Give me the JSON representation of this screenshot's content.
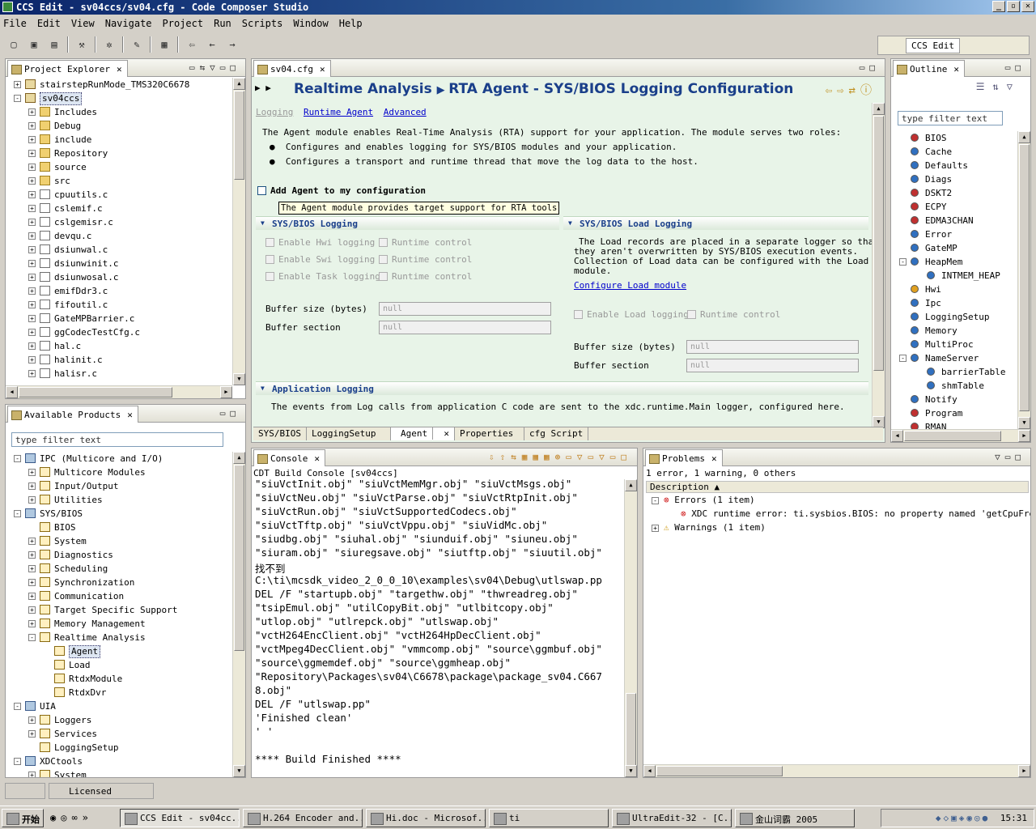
{
  "window": {
    "title": "CCS Edit - sv04ccs/sv04.cfg - Code Composer Studio",
    "controls": [
      "_",
      "▫",
      "✕"
    ]
  },
  "menu": [
    "File",
    "Edit",
    "View",
    "Navigate",
    "Project",
    "Run",
    "Scripts",
    "Window",
    "Help"
  ],
  "perspective": {
    "label": "CCS Edit"
  },
  "project_explorer": {
    "tab": "Project Explorer",
    "items": [
      {
        "label": "stairstepRunMode_TMS320C6678",
        "depth": 0,
        "kind": "prj",
        "expander": "+"
      },
      {
        "label": "sv04ccs",
        "depth": 0,
        "kind": "prj",
        "expander": "-",
        "selected": true
      },
      {
        "label": "Includes",
        "depth": 1,
        "kind": "folder",
        "expander": "+"
      },
      {
        "label": "Debug",
        "depth": 1,
        "kind": "folder",
        "expander": "+"
      },
      {
        "label": "include",
        "depth": 1,
        "kind": "folder",
        "expander": "+"
      },
      {
        "label": "Repository",
        "depth": 1,
        "kind": "folder",
        "expander": "+"
      },
      {
        "label": "source",
        "depth": 1,
        "kind": "folder",
        "expander": "+"
      },
      {
        "label": "src",
        "depth": 1,
        "kind": "folder",
        "expander": "+"
      },
      {
        "label": "cpuutils.c",
        "depth": 1,
        "kind": "file",
        "expander": "+"
      },
      {
        "label": "cslemif.c",
        "depth": 1,
        "kind": "file",
        "expander": "+"
      },
      {
        "label": "cslgemisr.c",
        "depth": 1,
        "kind": "file",
        "expander": "+"
      },
      {
        "label": "devqu.c",
        "depth": 1,
        "kind": "file",
        "expander": "+"
      },
      {
        "label": "dsiunwal.c",
        "depth": 1,
        "kind": "file",
        "expander": "+"
      },
      {
        "label": "dsiunwinit.c",
        "depth": 1,
        "kind": "file",
        "expander": "+"
      },
      {
        "label": "dsiunwosal.c",
        "depth": 1,
        "kind": "file",
        "expander": "+"
      },
      {
        "label": "emifDdr3.c",
        "depth": 1,
        "kind": "file",
        "expander": "+"
      },
      {
        "label": "fifoutil.c",
        "depth": 1,
        "kind": "file",
        "expander": "+"
      },
      {
        "label": "GateMPBarrier.c",
        "depth": 1,
        "kind": "file",
        "expander": "+"
      },
      {
        "label": "ggCodecTestCfg.c",
        "depth": 1,
        "kind": "file",
        "expander": "+"
      },
      {
        "label": "hal.c",
        "depth": 1,
        "kind": "file",
        "expander": "+"
      },
      {
        "label": "halinit.c",
        "depth": 1,
        "kind": "file",
        "expander": "+"
      },
      {
        "label": "halisr.c",
        "depth": 1,
        "kind": "file",
        "expander": "+"
      }
    ]
  },
  "available_products": {
    "tab": "Available Products",
    "filter_placeholder": "type filter text",
    "items": [
      {
        "label": "IPC (Multicore and I/O)",
        "depth": 0,
        "kind": "pkg",
        "expander": "-"
      },
      {
        "label": "Multicore Modules",
        "depth": 1,
        "kind": "mod",
        "expander": "+"
      },
      {
        "label": "Input/Output",
        "depth": 1,
        "kind": "mod",
        "expander": "+"
      },
      {
        "label": "Utilities",
        "depth": 1,
        "kind": "mod",
        "expander": "+"
      },
      {
        "label": "SYS/BIOS",
        "depth": 0,
        "kind": "pkg",
        "expander": "-"
      },
      {
        "label": "BIOS",
        "depth": 1,
        "kind": "mod",
        "expander": ""
      },
      {
        "label": "System",
        "depth": 1,
        "kind": "mod",
        "expander": "+"
      },
      {
        "label": "Diagnostics",
        "depth": 1,
        "kind": "mod",
        "expander": "+"
      },
      {
        "label": "Scheduling",
        "depth": 1,
        "kind": "mod",
        "expander": "+"
      },
      {
        "label": "Synchronization",
        "depth": 1,
        "kind": "mod",
        "expander": "+"
      },
      {
        "label": "Communication",
        "depth": 1,
        "kind": "mod",
        "expander": "+"
      },
      {
        "label": "Target Specific Support",
        "depth": 1,
        "kind": "mod",
        "expander": "+"
      },
      {
        "label": "Memory Management",
        "depth": 1,
        "kind": "mod",
        "expander": "+"
      },
      {
        "label": "Realtime Analysis",
        "depth": 1,
        "kind": "mod",
        "expander": "-"
      },
      {
        "label": "Agent",
        "depth": 2,
        "kind": "mod",
        "expander": "",
        "selected": true
      },
      {
        "label": "Load",
        "depth": 2,
        "kind": "mod",
        "expander": ""
      },
      {
        "label": "RtdxModule",
        "depth": 2,
        "kind": "mod",
        "expander": ""
      },
      {
        "label": "RtdxDvr",
        "depth": 2,
        "kind": "mod",
        "expander": ""
      },
      {
        "label": "UIA",
        "depth": 0,
        "kind": "pkg",
        "expander": "-"
      },
      {
        "label": "Loggers",
        "depth": 1,
        "kind": "mod",
        "expander": "+"
      },
      {
        "label": "Services",
        "depth": 1,
        "kind": "mod",
        "expander": "+"
      },
      {
        "label": "LoggingSetup",
        "depth": 1,
        "kind": "mod",
        "expander": ""
      },
      {
        "label": "XDCtools",
        "depth": 0,
        "kind": "pkg",
        "expander": "-"
      },
      {
        "label": "System",
        "depth": 1,
        "kind": "mod",
        "expander": "+"
      }
    ]
  },
  "editor": {
    "tab": "sv04.cfg",
    "breadcrumb_1": "Realtime Analysis",
    "breadcrumb_2": "RTA Agent - SYS/BIOS Logging Configuration",
    "links": {
      "logging": "Logging",
      "runtime_agent": "Runtime Agent",
      "advanced": "Advanced"
    },
    "intro": "The Agent module enables Real-Time Analysis (RTA) support for your application. The module serves two roles:",
    "bullet_1": "Configures and enables logging for SYS/BIOS modules and your application.",
    "bullet_2": "Configures a transport and runtime thread that move the log data to the host.",
    "add_agent": "Add Agent to my configuration",
    "tooltip": "The Agent module provides target support for RTA tools",
    "sysbios_logging": {
      "title": "SYS/BIOS Logging",
      "hwi": "Enable Hwi logging",
      "swi": "Enable Swi logging",
      "task": "Enable Task logging",
      "runtime": "Runtime control",
      "buffer_size_label": "Buffer size (bytes)",
      "buffer_section_label": "Buffer section",
      "buffer_size_value": "null",
      "buffer_section_value": "null"
    },
    "load_logging": {
      "title": "SYS/BIOS Load Logging",
      "desc_1": "The Load records are placed in a separate logger so that",
      "desc_2": "they aren't overwritten by SYS/BIOS execution events.",
      "desc_3": "Collection of Load data can be configured with the Load",
      "desc_4": "module.",
      "configure_link": "Configure Load module",
      "enable": "Enable Load logging",
      "runtime": "Runtime control",
      "buffer_size_label": "Buffer size (bytes)",
      "buffer_section_label": "Buffer section",
      "buffer_size_value": "null",
      "buffer_section_value": "null"
    },
    "app_logging": {
      "title": "Application Logging",
      "desc": "The events from Log calls from application C code are sent to the xdc.runtime.Main logger, configured here."
    },
    "bottom_tabs": [
      "SYS/BIOS",
      "LoggingSetup",
      "Agent",
      "Properties",
      "cfg Script"
    ]
  },
  "outline": {
    "tab": "Outline",
    "filter_placeholder": "type filter text",
    "items": [
      {
        "label": "BIOS",
        "color": "#c03030",
        "depth": 0
      },
      {
        "label": "Cache",
        "color": "#3070c0",
        "depth": 0
      },
      {
        "label": "Defaults",
        "color": "#3070c0",
        "depth": 0
      },
      {
        "label": "Diags",
        "color": "#3070c0",
        "depth": 0
      },
      {
        "label": "DSKT2",
        "color": "#c03030",
        "depth": 0
      },
      {
        "label": "ECPY",
        "color": "#c03030",
        "depth": 0
      },
      {
        "label": "EDMA3CHAN",
        "color": "#c03030",
        "depth": 0
      },
      {
        "label": "Error",
        "color": "#3070c0",
        "depth": 0
      },
      {
        "label": "GateMP",
        "color": "#3070c0",
        "depth": 0
      },
      {
        "label": "HeapMem",
        "color": "#3070c0",
        "depth": 0,
        "expander": "-"
      },
      {
        "label": "INTMEM_HEAP",
        "color": "#3070c0",
        "depth": 1
      },
      {
        "label": "Hwi",
        "color": "#e0a020",
        "depth": 0
      },
      {
        "label": "Ipc",
        "color": "#3070c0",
        "depth": 0
      },
      {
        "label": "LoggingSetup",
        "color": "#3070c0",
        "depth": 0
      },
      {
        "label": "Memory",
        "color": "#3070c0",
        "depth": 0
      },
      {
        "label": "MultiProc",
        "color": "#3070c0",
        "depth": 0
      },
      {
        "label": "NameServer",
        "color": "#3070c0",
        "depth": 0,
        "expander": "-"
      },
      {
        "label": "barrierTable",
        "color": "#3070c0",
        "depth": 1
      },
      {
        "label": "shmTable",
        "color": "#3070c0",
        "depth": 1
      },
      {
        "label": "Notify",
        "color": "#3070c0",
        "depth": 0
      },
      {
        "label": "Program",
        "color": "#c03030",
        "depth": 0
      },
      {
        "label": "RMAN",
        "color": "#c03030",
        "depth": 0
      }
    ]
  },
  "console": {
    "tab": "Console",
    "subtitle": "CDT Build Console [sv04ccs]",
    "lines": [
      "\"siuVctInit.obj\" \"siuVctMemMgr.obj\" \"siuVctMsgs.obj\"",
      "\"siuVctNeu.obj\" \"siuVctParse.obj\" \"siuVctRtpInit.obj\"",
      "\"siuVctRun.obj\" \"siuVctSupportedCodecs.obj\"",
      "\"siuVctTftp.obj\" \"siuVctVppu.obj\" \"siuVidMc.obj\"",
      "\"siudbg.obj\" \"siuhal.obj\" \"siunduif.obj\" \"siuneu.obj\"",
      "\"siuram.obj\" \"siuregsave.obj\" \"siutftp.obj\" \"siuutil.obj\"",
      "找不到",
      "C:\\ti\\mcsdk_video_2_0_0_10\\examples\\sv04\\Debug\\utlswap.pp",
      "DEL /F \"startupb.obj\" \"targethw.obj\" \"thwreadreg.obj\"",
      "\"tsipEmul.obj\" \"utilCopyBit.obj\" \"utlbitcopy.obj\"",
      "\"utlop.obj\" \"utlrepck.obj\" \"utlswap.obj\"",
      "\"vctH264EncClient.obj\" \"vctH264HpDecClient.obj\"",
      "\"vctMpeg4DecClient.obj\" \"vmmcomp.obj\" \"source\\ggmbuf.obj\"",
      "\"source\\ggmemdef.obj\" \"source\\ggmheap.obj\"",
      "\"Repository\\Packages\\sv04\\C6678\\package\\package_sv04.C667",
      "8.obj\"",
      "DEL /F \"utlswap.pp\"",
      "'Finished clean'",
      "' '",
      "",
      "**** Build Finished ****"
    ]
  },
  "problems": {
    "tab": "Problems",
    "summary": "1 error, 1 warning, 0 others",
    "column": "Description",
    "errors_label": "Errors (1 item)",
    "error_item": "XDC runtime error: ti.sysbios.BIOS: no property named 'getCpuFrequenc",
    "warnings_label": "Warnings (1 item)"
  },
  "status": {
    "license": "Licensed"
  },
  "taskbar": {
    "start": "开始",
    "buttons": [
      "CCS Edit - sv04cc...",
      "H.264 Encoder and...",
      "Hi.doc - Microsof...",
      "ti",
      "UltraEdit-32 - [C...",
      "金山词霸 2005"
    ],
    "clock": "15:31"
  }
}
